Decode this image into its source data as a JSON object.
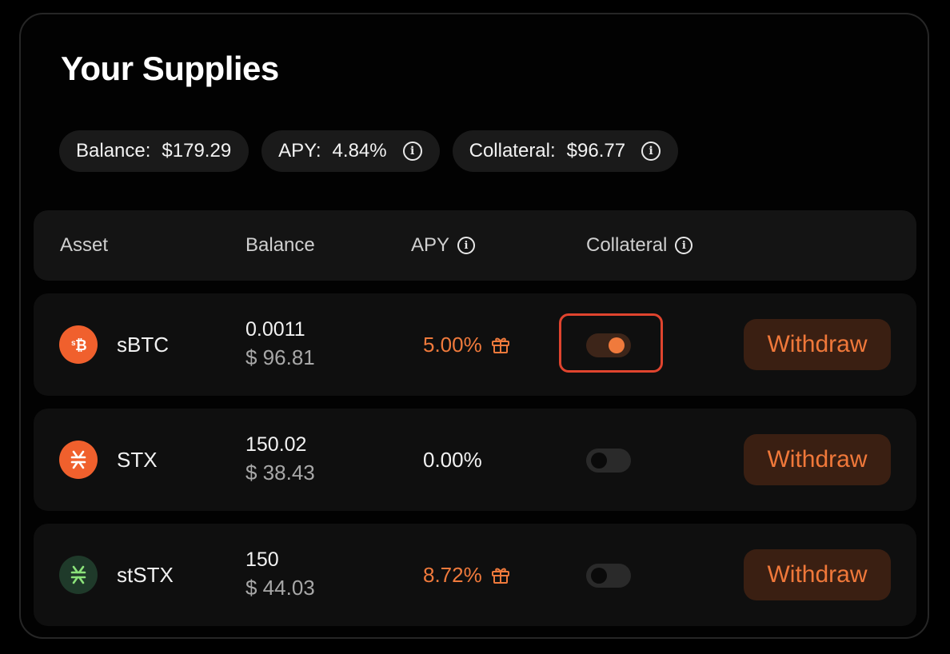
{
  "title": "Your Supplies",
  "summary": {
    "balance_label": "Balance:",
    "balance_value": "$179.29",
    "apy_label": "APY:",
    "apy_value": "4.84%",
    "collateral_label": "Collateral:",
    "collateral_value": "$96.77"
  },
  "table": {
    "headers": {
      "asset": "Asset",
      "balance": "Balance",
      "apy": "APY",
      "collateral": "Collateral"
    },
    "rows": [
      {
        "asset": "sBTC",
        "icon": "sbtc-coin-icon",
        "amount": "0.0011",
        "usd": "$ 96.81",
        "apy": "5.00%",
        "reward": true,
        "collateral": true,
        "action": "Withdraw"
      },
      {
        "asset": "STX",
        "icon": "stx-coin-icon",
        "amount": "150.02",
        "usd": "$ 38.43",
        "apy": "0.00%",
        "reward": false,
        "collateral": false,
        "action": "Withdraw"
      },
      {
        "asset": "stSTX",
        "icon": "ststx-coin-icon",
        "amount": "150",
        "usd": "$ 44.03",
        "apy": "8.72%",
        "reward": true,
        "collateral": false,
        "action": "Withdraw"
      }
    ]
  },
  "colors": {
    "accent": "#f07a3c",
    "highlight": "#e0442e",
    "withdraw_bg": "#3a1f12",
    "card_border": "#262626"
  }
}
